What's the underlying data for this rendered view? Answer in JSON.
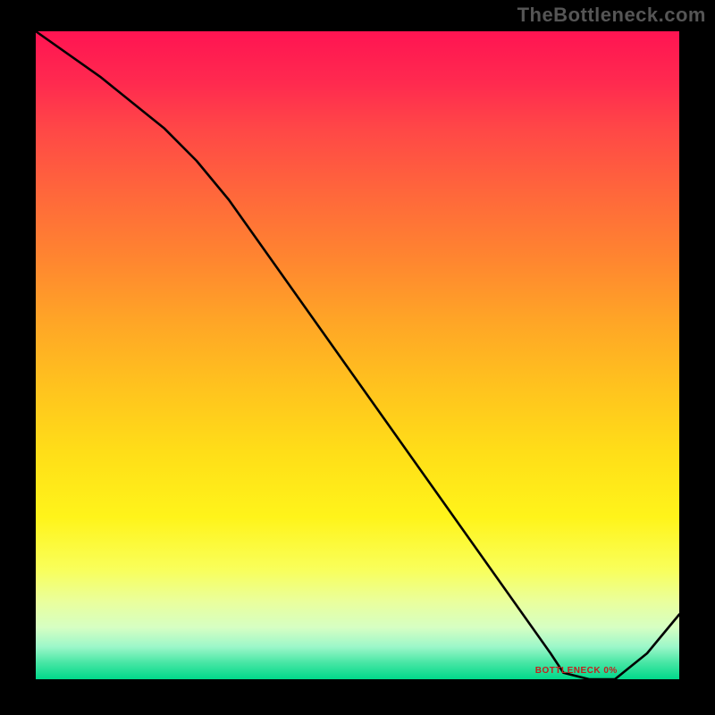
{
  "watermark": "TheBottleneck.com",
  "annotation_text": "BOTTLENECK 0%",
  "chart_data": {
    "type": "line",
    "title": "",
    "xlabel": "",
    "ylabel": "",
    "xlim": [
      0,
      100
    ],
    "ylim": [
      0,
      100
    ],
    "series": [
      {
        "name": "bottleneck-curve",
        "x": [
          0,
          10,
          20,
          25,
          30,
          40,
          50,
          60,
          70,
          80,
          82,
          86,
          90,
          95,
          100
        ],
        "y": [
          100,
          93,
          85,
          80,
          74,
          60,
          46,
          32,
          18,
          4,
          1,
          0,
          0,
          4,
          10
        ]
      }
    ],
    "annotations": [
      {
        "text_ref": "annotation_text",
        "x": 84,
        "y": 0
      }
    ],
    "gradient_stops": [
      {
        "pos": 0.0,
        "color": "#ff1452"
      },
      {
        "pos": 0.5,
        "color": "#ffc31e"
      },
      {
        "pos": 0.88,
        "color": "#eaff9c"
      },
      {
        "pos": 1.0,
        "color": "#00d88a"
      }
    ]
  }
}
